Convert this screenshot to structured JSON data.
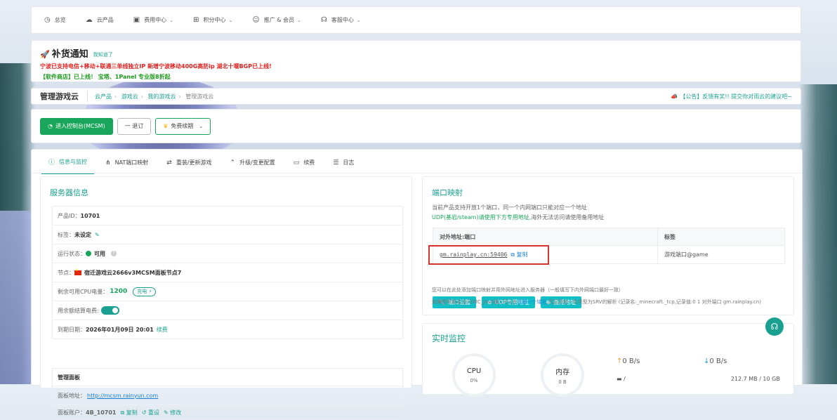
{
  "nav": [
    {
      "icon": "dashboard-icon",
      "glyph": "◷",
      "label": "总览",
      "chevron": false
    },
    {
      "icon": "cloud-icon",
      "glyph": "☁",
      "label": "云产品",
      "chevron": false
    },
    {
      "icon": "video-icon",
      "glyph": "▣",
      "label": "费用中心",
      "chevron": true
    },
    {
      "icon": "gift-icon",
      "glyph": "⊞",
      "label": "积分中心",
      "chevron": true
    },
    {
      "icon": "users-icon",
      "glyph": "☺",
      "label": "推广 & 会员",
      "chevron": true
    },
    {
      "icon": "headset-icon",
      "glyph": "☊",
      "label": "客服中心",
      "chevron": true
    }
  ],
  "notice": {
    "title": "补货通知",
    "know": "我知道了",
    "line1": "宁波已支持电信+移动+联通三单线独立IP 新增宁波移动400G高防ip 湖北十堰BGP已上线!",
    "line2_highlight": "【软件商店】",
    "line2_rest": "已上线！ 宝塔、1Panel 专业版8折起"
  },
  "breadcrumb": {
    "title": "管理游戏云",
    "path": [
      "云产品",
      "游戏云",
      "我的游戏云",
      "管理游戏云"
    ],
    "announcement": "【公告】反馈有奖!! 提交你对雨云的建议吧~"
  },
  "actions": {
    "enter_panel": "进入控制台(MCSM)",
    "refund": "一 退订",
    "free_renew": "免费续期"
  },
  "tabs": [
    {
      "icon": "info-icon",
      "glyph": "ⓘ",
      "label": "信息与监控",
      "active": true
    },
    {
      "icon": "network-icon",
      "glyph": "⋔",
      "label": "NAT端口映射",
      "active": false
    },
    {
      "icon": "reinstall-icon",
      "glyph": "⇄",
      "label": "重装/更新游戏",
      "active": false
    },
    {
      "icon": "upgrade-icon",
      "glyph": "⌃",
      "label": "升级/变更配置",
      "active": false
    },
    {
      "icon": "renew-icon",
      "glyph": "▭",
      "label": "续费",
      "active": false
    },
    {
      "icon": "log-icon",
      "glyph": "☰",
      "label": "日志",
      "active": false
    }
  ],
  "server": {
    "title": "服务器信息",
    "product_id_label": "产品ID：",
    "product_id": "10701",
    "tag_label": "标签：",
    "tag": "未设定",
    "status_label": "运行状态：",
    "status": "可用",
    "node_label": "节点：",
    "node": "宿迁游戏云2666v3MCSM面板节点7",
    "cpu_label": "剩余可用CPU电量：",
    "cpu": "1200",
    "recharge": "充电",
    "balance_label": "用余额结算电费:",
    "expire_label": "到期日期：",
    "expire": "2026年01月09日 20:01",
    "renew": "续费",
    "panel_title": "管理面板",
    "panel_addr_label": "面板地址：",
    "panel_addr": "http://mcsm.rainyun.com",
    "panel_account_label": "面板账户：",
    "panel_account": "4B_10701",
    "copy": "复制",
    "reset": "重设",
    "modify": "修改"
  },
  "port": {
    "title": "端口映射",
    "desc1": "当前产品支持开放1个端口，同一个内网端口只能对应一个地址",
    "desc2_hl": "UDP(基岩/steam)请使用下方专用地址,",
    "desc2_rest": "海外无法访问请使用备用地址",
    "col_addr": "对外地址:端口",
    "col_tag": "标签",
    "address": "gm.rainplay.cn:59406",
    "copy": "复制",
    "tag": "游戏端口@game",
    "btn_settings": "端口设置",
    "btn_udp": "UDP专用地址",
    "btn_backup": "备用地址",
    "note1": "您可以在此处添加端口映射并用外网地址进入服务器（一般填写下内外网端口最好一致）",
    "note2_a": "如果想用域名访问(MC_JAVA版),可以去",
    "note2_link": "注册一个域名",
    "note2_b": ",然后添加一条类型为SRV的解析 (记录名:_minecraft._tcp,记录值:0 1 对外端口 gm.rainplay.cn)"
  },
  "monitor": {
    "title": "实时监控",
    "cpu_label": "CPU",
    "cpu_val": "0%",
    "mem_label": "内存",
    "mem_val": "0 B",
    "up": "0 B/s",
    "down": "0 B/s",
    "disk": "212.7 MB / 10 GB"
  }
}
